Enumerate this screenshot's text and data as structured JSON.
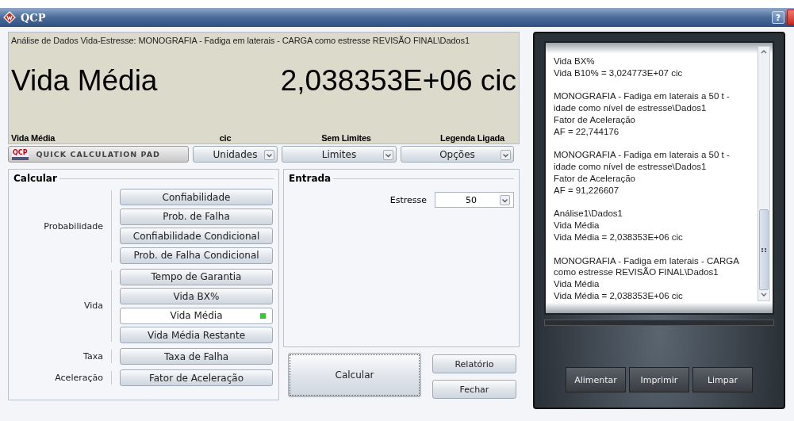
{
  "window": {
    "title": "QCP",
    "help": "?"
  },
  "display": {
    "path": "Análise de Dados Vida-Estresse: MONOGRAFIA - Fadiga em laterais - CARGA como estresse REVISÃO FINAL\\Dados1",
    "quantity": "Vida Média",
    "value": "2,038353E+06 cic",
    "status": [
      "Vida Média",
      "cic",
      "Sem Limites",
      "Legenda Ligada"
    ]
  },
  "toolbar": {
    "logo": "QCP",
    "pad_button": "QUICK CALCULATION PAD",
    "dropdowns": [
      "Unidades",
      "Limites",
      "Opções"
    ]
  },
  "calcular": {
    "title": "Calcular",
    "groups": [
      {
        "label": "Probabilidade",
        "buttons": [
          {
            "label": "Confiabilidade",
            "selected": false
          },
          {
            "label": "Prob. de Falha",
            "selected": false
          },
          {
            "label": "Confiabilidade Condicional",
            "selected": false
          },
          {
            "label": "Prob. de Falha Condicional",
            "selected": false
          }
        ]
      },
      {
        "label": "Vida",
        "buttons": [
          {
            "label": "Tempo de Garantia",
            "selected": false
          },
          {
            "label": "Vida BX%",
            "selected": false
          },
          {
            "label": "Vida Média",
            "selected": true
          },
          {
            "label": "Vida Média Restante",
            "selected": false
          }
        ]
      },
      {
        "label": "Taxa",
        "buttons": [
          {
            "label": "Taxa de Falha",
            "selected": false
          }
        ]
      },
      {
        "label": "Aceleração",
        "buttons": [
          {
            "label": "Fator de Aceleração",
            "selected": false
          }
        ]
      }
    ]
  },
  "entrada": {
    "title": "Entrada",
    "fields": [
      {
        "label": "Estresse",
        "value": "50"
      }
    ]
  },
  "actions": {
    "calculate": "Calcular",
    "side": [
      "Relatório",
      "Fechar"
    ]
  },
  "log": {
    "entries": [
      [
        "Vida BX%",
        "Vida B10% = 3,024773E+07 cic"
      ],
      [
        "MONOGRAFIA - Fadiga em laterais a 50 t -",
        "idade como nível de estresse\\Dados1",
        "Fator de Aceleração",
        "AF = 22,744176"
      ],
      [
        "MONOGRAFIA - Fadiga em laterais a 50 t -",
        "idade como nível de estresse\\Dados1",
        "Fator de Aceleração",
        "AF = 91,226607"
      ],
      [
        "Análise1\\Dados1",
        "Vida Média",
        "Vida Média = 2,038353E+06 cic"
      ],
      [
        "MONOGRAFIA - Fadiga em laterais - CARGA",
        "como estresse REVISÃO FINAL\\Dados1",
        "Vida Média",
        "Vida Média = 2,038353E+06 cic"
      ]
    ],
    "buttons": [
      "Alimentar",
      "Imprimir",
      "Limpar"
    ]
  }
}
